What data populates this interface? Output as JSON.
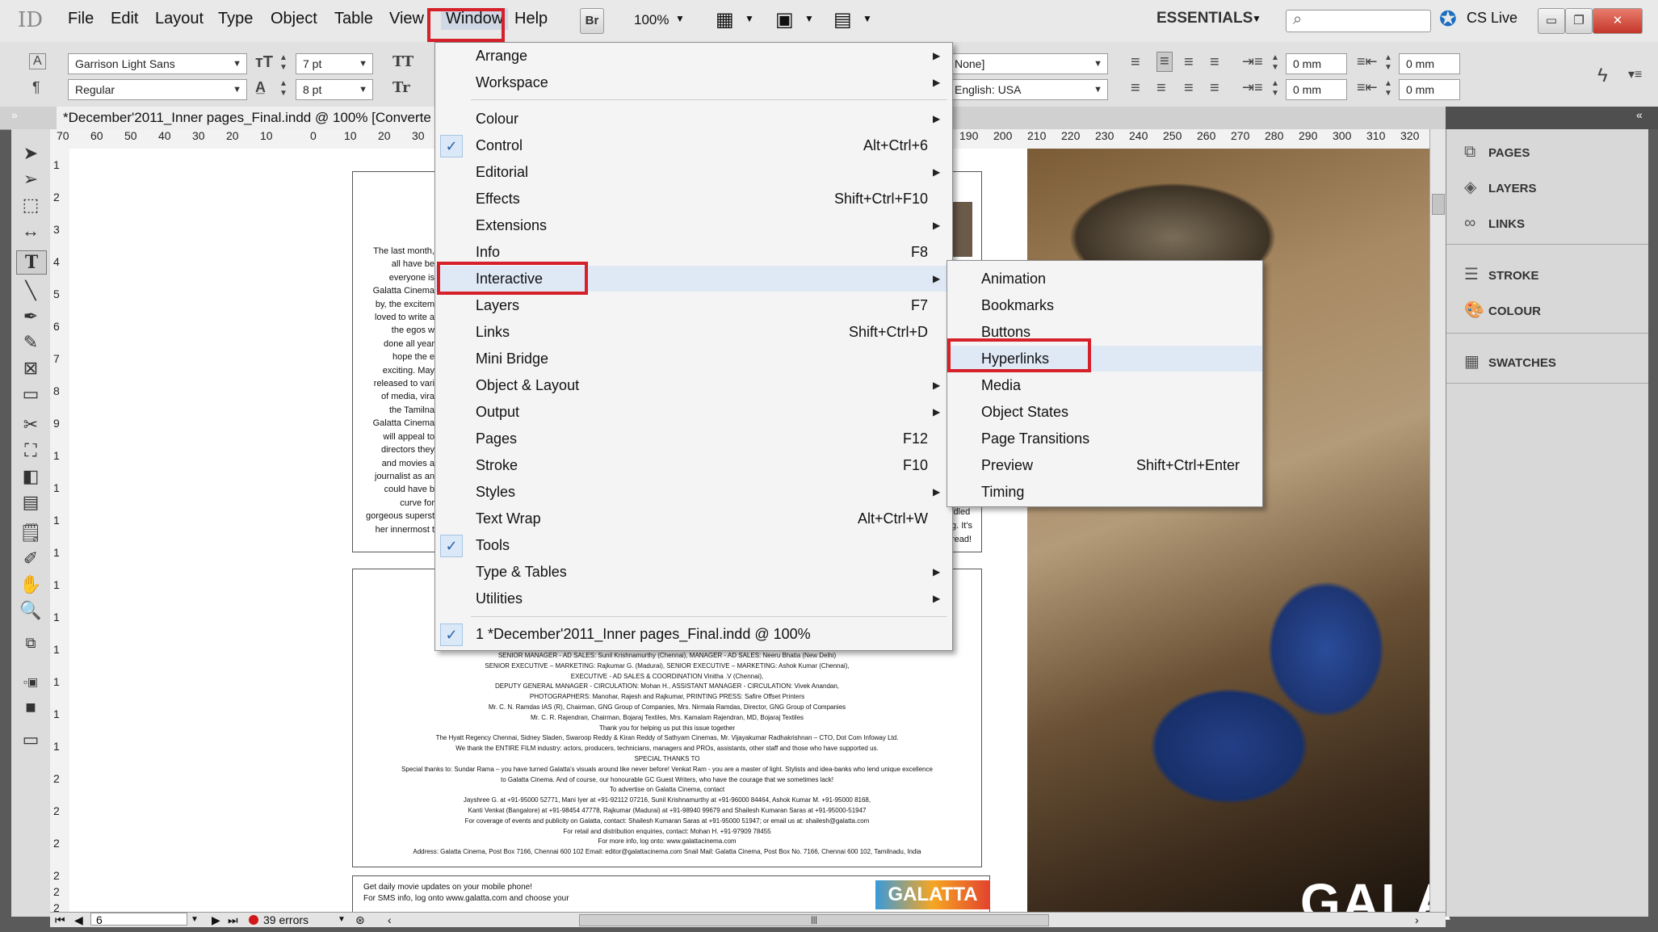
{
  "menubar": {
    "logo": "ID",
    "items": [
      "File",
      "Edit",
      "Layout",
      "Type",
      "Object",
      "Table",
      "View",
      "Window",
      "Help"
    ],
    "bridge": "Br",
    "zoom": "100%",
    "workspace": "ESSENTIALS",
    "cs_live": "CS Live"
  },
  "control": {
    "font_family": "Garrison Light Sans",
    "font_style": "Regular",
    "font_size": "7 pt",
    "leading": "8 pt",
    "tt1": "TT",
    "tt2": "Tr",
    "char_style": "None]",
    "language": "English: USA",
    "indent1": "0 mm",
    "indent2": "0 mm",
    "indent3": "0 mm",
    "indent4": "0 mm"
  },
  "doc_tab": "*December'2011_Inner pages_Final.indd @ 100% [Converte",
  "ruler_h": [
    "70",
    "60",
    "50",
    "40",
    "30",
    "20",
    "10",
    "0",
    "10",
    "20",
    "30",
    "190",
    "200",
    "210",
    "220",
    "230",
    "240",
    "250",
    "260",
    "270",
    "280",
    "290",
    "300",
    "310",
    "320"
  ],
  "ruler_v": [
    "1",
    "2",
    "3",
    "4",
    "5",
    "6",
    "7",
    "8",
    "9",
    "1",
    "1",
    "1",
    "1",
    "1",
    "1",
    "1",
    "1",
    "1",
    "1",
    "2",
    "2",
    "2",
    "2",
    "2",
    "2"
  ],
  "right_panel": [
    "PAGES",
    "LAYERS",
    "LINKS",
    "STROKE",
    "COLOUR",
    "SWATCHES"
  ],
  "window_menu": [
    {
      "label": "Arrange",
      "shortcut": "",
      "arrow": true,
      "check": false
    },
    {
      "label": "Workspace",
      "shortcut": "",
      "arrow": true,
      "check": false
    },
    {
      "label": "Colour",
      "shortcut": "",
      "arrow": true,
      "check": false
    },
    {
      "label": "Control",
      "shortcut": "Alt+Ctrl+6",
      "arrow": false,
      "check": true
    },
    {
      "label": "Editorial",
      "shortcut": "",
      "arrow": true,
      "check": false
    },
    {
      "label": "Effects",
      "shortcut": "Shift+Ctrl+F10",
      "arrow": false,
      "check": false
    },
    {
      "label": "Extensions",
      "shortcut": "",
      "arrow": true,
      "check": false
    },
    {
      "label": "Info",
      "shortcut": "F8",
      "arrow": false,
      "check": false
    },
    {
      "label": "Interactive",
      "shortcut": "",
      "arrow": true,
      "check": false
    },
    {
      "label": "Layers",
      "shortcut": "F7",
      "arrow": false,
      "check": false
    },
    {
      "label": "Links",
      "shortcut": "Shift+Ctrl+D",
      "arrow": false,
      "check": false
    },
    {
      "label": "Mini Bridge",
      "shortcut": "",
      "arrow": false,
      "check": false
    },
    {
      "label": "Object & Layout",
      "shortcut": "",
      "arrow": true,
      "check": false
    },
    {
      "label": "Output",
      "shortcut": "",
      "arrow": true,
      "check": false
    },
    {
      "label": "Pages",
      "shortcut": "F12",
      "arrow": false,
      "check": false
    },
    {
      "label": "Stroke",
      "shortcut": "F10",
      "arrow": false,
      "check": false
    },
    {
      "label": "Styles",
      "shortcut": "",
      "arrow": true,
      "check": false
    },
    {
      "label": "Text Wrap",
      "shortcut": "Alt+Ctrl+W",
      "arrow": false,
      "check": false
    },
    {
      "label": "Tools",
      "shortcut": "",
      "arrow": false,
      "check": true
    },
    {
      "label": "Type & Tables",
      "shortcut": "",
      "arrow": true,
      "check": false
    },
    {
      "label": "Utilities",
      "shortcut": "",
      "arrow": true,
      "check": false
    },
    {
      "label": "1 *December'2011_Inner pages_Final.indd @ 100%",
      "shortcut": "",
      "arrow": false,
      "check": true
    }
  ],
  "interactive_submenu": [
    {
      "label": "Animation",
      "shortcut": ""
    },
    {
      "label": "Bookmarks",
      "shortcut": ""
    },
    {
      "label": "Buttons",
      "shortcut": ""
    },
    {
      "label": "Hyperlinks",
      "shortcut": ""
    },
    {
      "label": "Media",
      "shortcut": ""
    },
    {
      "label": "Object States",
      "shortcut": ""
    },
    {
      "label": "Page Transitions",
      "shortcut": ""
    },
    {
      "label": "Preview",
      "shortcut": "Shift+Ctrl+Enter"
    },
    {
      "label": "Timing",
      "shortcut": ""
    }
  ],
  "page_text": {
    "left_column": [
      "The last month,",
      "all have be",
      "everyone is",
      "Galatta Cinema",
      "by, the excitem",
      "loved to write a",
      "the egos w",
      "done all year",
      "hope the e",
      "exciting. May",
      "released to vari",
      "of media, vira",
      "the Tamilna",
      "Galatta Cinema",
      "will appeal to",
      "directors they",
      "and movies a",
      "journalist as an",
      "could have b",
      "curve for",
      "gorgeous superst",
      "her innermost t"
    ],
    "right_fragments": [
      "idled",
      "g. It's",
      "read!"
    ],
    "credits": [
      "SENIOR MANAGER - AD SALES: Sunil Krishnamurthy (Chennai), MANAGER - AD SALES: Neeru Bhatia (New Delhi)",
      "SENIOR EXECUTIVE – MARKETING: Rajkumar G. (Madurai), SENIOR EXECUTIVE – MARKETING: Ashok Kumar (Chennai),",
      "EXECUTIVE - AD SALES & COORDINATION Vinitha .V (Chennai),",
      "DEPUTY GENERAL MANAGER - CIRCULATION: Mohan H., ASSISTANT MANAGER - CIRCULATION: Vivek Anandan,",
      "PHOTOGRAPHERS: Manohar, Rajesh and Rajkumar, PRINTING PRESS: Safire Offset Printers",
      "Mr. C. N. Ramdas IAS (R), Chairman, GNG Group of Companies, Mrs. Nirmala Ramdas, Director, GNG Group of Companies",
      "Mr. C. R. Rajendran, Chairman, Bojaraj Textiles, Mrs. Kamalam Rajendran, MD, Bojaraj Textiles",
      "Thank you for helping us put this issue together",
      "The Hyatt Regency Chennai, Sidney Sladen, Swaroop Reddy & Kiran Reddy of Sathyam Cinemas, Mr. Vijayakumar Radhakrishnan – CTO, Dot Com Infoway Ltd.",
      "We thank the ENTIRE FILM industry: actors, producers, technicians, managers and PROs, assistants, other staff and those who have supported us.",
      "SPECIAL THANKS TO",
      "Special thanks to: Sundar Rama – you have turned Galatta's visuals around like never before! Venkat Ram - you are a master of light. Stylists and idea-banks who lend unique excellence",
      "to Galatta Cinema. And of course, our honourable GC Guest Writers, who have the courage that we sometimes lack!",
      "To advertise on Galatta Cinema, contact",
      "Jayshree G. at +91-95000 52771, Mani Iyer at +91-92112 07216, Sunil Krishnamurthy at +91-96000 84464, Ashok Kumar M. +91-95000 8168,",
      "Kanti Venkat (Bangalore) at +91-98454 47778, Rajkumar (Madurai) at +91-98940 99679 and Shailesh Kumaran Saras at +91-95000-51947",
      "For coverage of events and publicity on Galatta, contact: Shailesh Kumaran Saras at +91-95000 51947; or email us at: shailesh@galatta.com",
      "For retail and distribution enquiries, contact: Mohan H. +91-97909 78455",
      "For more info, log onto: www.galattacinema.com",
      "Address: Galatta Cinema, Post Box 7166, Chennai 600 102 Email: editor@galattacinema.com Snail Mail: Galatta Cinema, Post Box No. 7166, Chennai 600 102, Tamilnadu, India"
    ],
    "sms_line1": "Get daily movie updates on your mobile phone!",
    "sms_line2": "For SMS info, log onto www.galatta.com and choose your",
    "logo_text": "GALATTA",
    "photo_text": "GALA"
  },
  "status": {
    "page": "6",
    "errors": "39 errors"
  },
  "colors": {
    "highlight_red": "#d6202a",
    "check_blue": "#2b5fa8",
    "error_red": "#d01818"
  }
}
